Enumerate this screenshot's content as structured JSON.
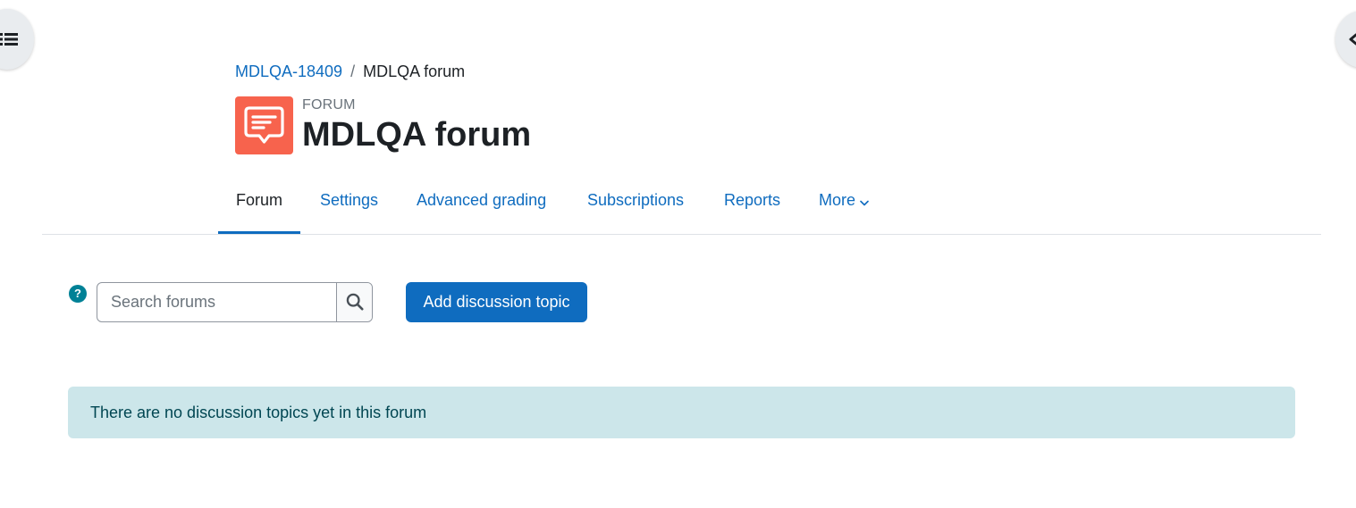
{
  "drawers": {
    "left_icon": "list-icon",
    "right_icon": "chevron-left-icon"
  },
  "breadcrumb": {
    "items": [
      {
        "label": "MDLQA-18409"
      },
      {
        "label": "MDLQA forum"
      }
    ],
    "separator": "/"
  },
  "header": {
    "activity_type": "FORUM",
    "title": "MDLQA forum",
    "icon": "forum-chat-icon",
    "icon_color": "#f7634d"
  },
  "nav": {
    "items": [
      {
        "label": "Forum",
        "active": true
      },
      {
        "label": "Settings"
      },
      {
        "label": "Advanced grading"
      },
      {
        "label": "Subscriptions"
      },
      {
        "label": "Reports"
      },
      {
        "label": "More"
      }
    ]
  },
  "search": {
    "placeholder": "Search forums",
    "value": "",
    "button_icon": "search-icon"
  },
  "actions": {
    "add_topic_label": "Add discussion topic",
    "help_glyph": "?"
  },
  "alert": {
    "text": "There are no discussion topics yet in this forum"
  },
  "colors": {
    "brand": "#0f6cbf",
    "alert_bg": "#cce6ea",
    "alert_text": "#004652",
    "help": "#008196"
  }
}
